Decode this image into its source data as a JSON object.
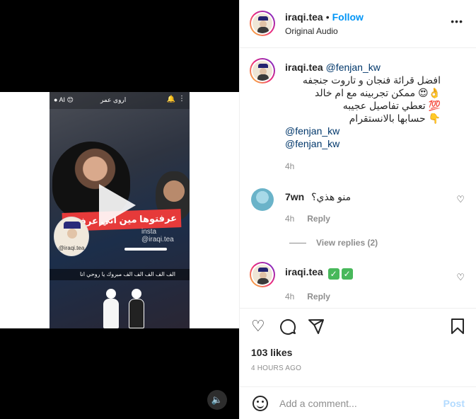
{
  "header": {
    "username": "iraqi.tea",
    "separator": "•",
    "follow_label": "Follow",
    "audio_label": "Original Audio",
    "more_icon": "more-horizontal-icon"
  },
  "video": {
    "top_label": "اروى عمر",
    "banner_text": "عرفتوها مين اني عرفتهم",
    "watermark": "insta @iraqi.tea",
    "logo_text": "@iraqi.tea",
    "caption": "الف الف الف الف الف مبروك يا روحي انا",
    "play_icon": "play-icon",
    "volume_icon": "volume-icon"
  },
  "caption": {
    "username": "iraqi.tea",
    "mention": "@fenjan_kw",
    "lines": [
      "افضل قرائة فنجان و تاروت جنجفه",
      "👌😍 ممكن تجربينه مع ام خالد",
      "💯 تعطي تفاصيل عجيبه",
      "👇 حسابها بالانستقرام"
    ],
    "mention_line_1": "@fenjan_kw",
    "mention_line_2": "@fenjan_kw",
    "time": "4h"
  },
  "comment1": {
    "username": "7wn",
    "text": "منو هذي؟",
    "time": "4h",
    "reply_label": "Reply",
    "view_replies": "View replies (2)"
  },
  "comment2": {
    "username": "iraqi.tea",
    "text": "✅ ✅",
    "time": "4h",
    "reply_label": "Reply"
  },
  "actions": {
    "like_icon": "heart-icon",
    "comment_icon": "comment-icon",
    "share_icon": "share-icon",
    "save_icon": "bookmark-icon"
  },
  "likes": "103 likes",
  "time_ago": "4 HOURS AGO",
  "comment_box": {
    "placeholder": "Add a comment...",
    "post_label": "Post"
  }
}
